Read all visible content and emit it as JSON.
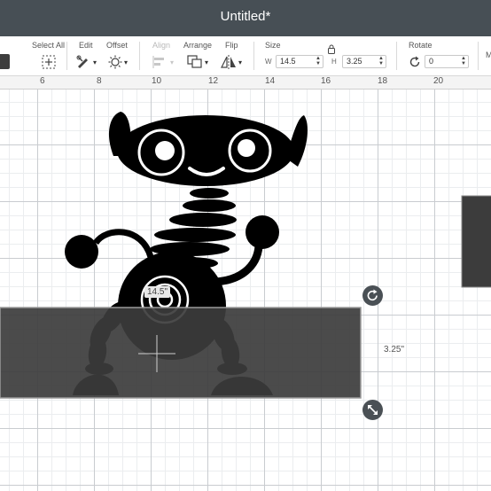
{
  "window": {
    "title": "Untitled*"
  },
  "toolbar": {
    "select_all": "Select All",
    "edit": "Edit",
    "offset": "Offset",
    "align": "Align",
    "arrange": "Arrange",
    "flip": "Flip",
    "size": {
      "label": "Size",
      "w_label": "W",
      "w_value": "14.5",
      "h_label": "H",
      "h_value": "3.25"
    },
    "rotate": {
      "label": "Rotate",
      "value": "0"
    },
    "more_label": "M"
  },
  "ruler": {
    "ticks": [
      "6",
      "8",
      "10",
      "12",
      "14",
      "16",
      "18",
      "20"
    ]
  },
  "canvas": {
    "width_readout": "14.5\"",
    "height_readout": "3.25\"",
    "fill_color": "#3c3c3c",
    "grid_color": "#c9ccd0"
  },
  "icons": [
    "select-all-icon",
    "edit-icon",
    "offset-icon",
    "align-icon",
    "arrange-icon",
    "flip-icon",
    "lock-icon",
    "rotate-icon",
    "rotate-handle-icon",
    "resize-handle-icon"
  ]
}
